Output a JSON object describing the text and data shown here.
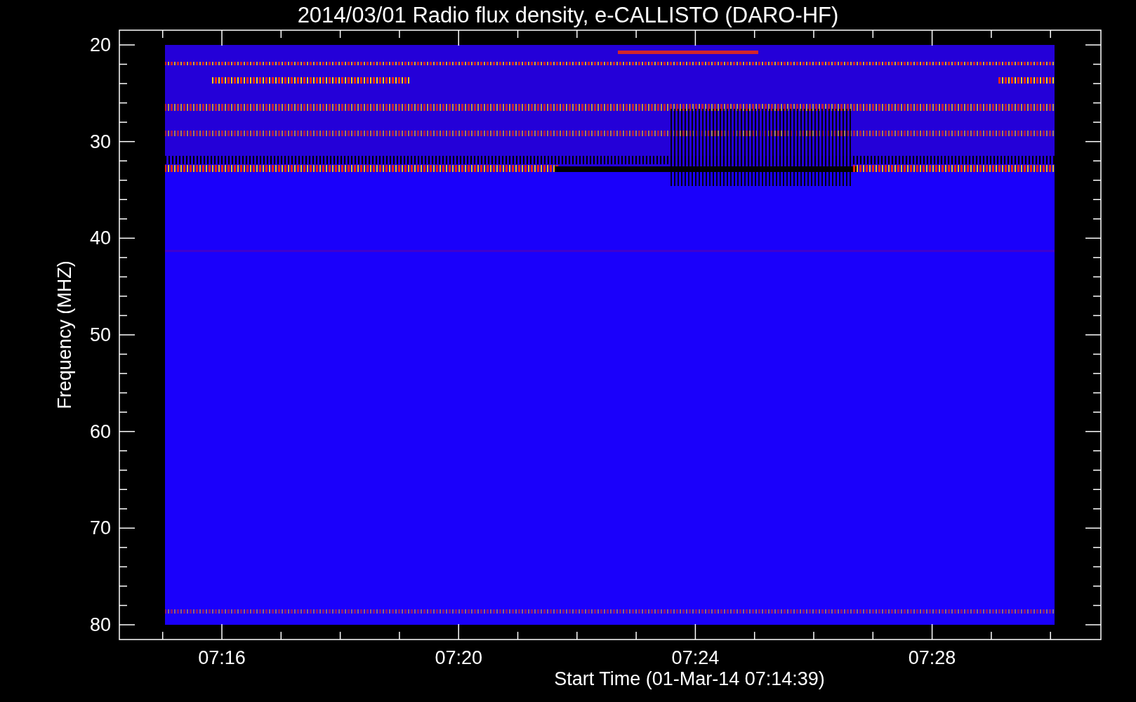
{
  "plot": {
    "title": "2014/03/01  Radio flux density, e-CALLISTO (DARO-HF)",
    "ylabel": "Frequency (MHZ)",
    "xlabel": "Start Time (01-Mar-14 07:14:39)",
    "y_tick_labels": [
      "20",
      "30",
      "40",
      "50",
      "60",
      "70",
      "80"
    ],
    "x_tick_labels": [
      "07:16",
      "07:20",
      "07:24",
      "07:28"
    ]
  }
}
